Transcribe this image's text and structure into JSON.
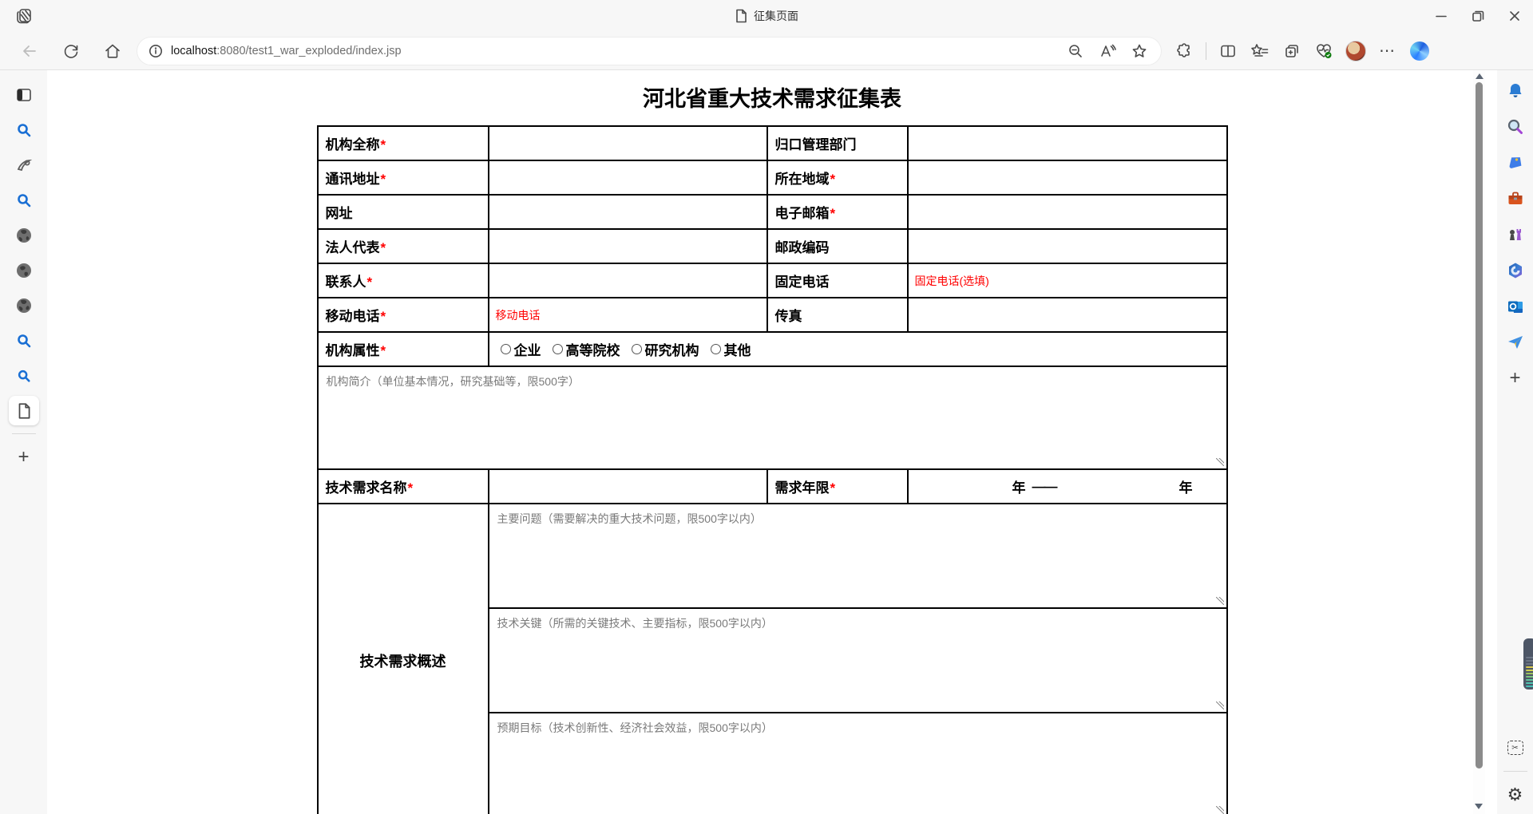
{
  "window": {
    "tab_title": "征集页面"
  },
  "toolbar": {
    "url": {
      "host": "localhost",
      "path": ":8080/test1_war_exploded/index.jsp"
    }
  },
  "icons": {
    "more": "⋯",
    "plus": "+",
    "gear": "⚙",
    "scissors": "✂",
    "read_aloud": "A"
  },
  "page": {
    "title": "河北省重大技术需求征集表",
    "required_mark": "*",
    "form": {
      "org_name_label": "机构全称",
      "dept_label": "归口管理部门",
      "address_label": "通讯地址",
      "region_label": "所在地域",
      "website_label": "网址",
      "email_label": "电子邮箱",
      "legal_label": "法人代表",
      "postcode_label": "邮政编码",
      "contact_label": "联系人",
      "landline_label": "固定电话",
      "landline_placeholder": "固定电话(选填)",
      "mobile_label": "移动电话",
      "mobile_placeholder": "移动电话",
      "fax_label": "传真",
      "org_type_label": "机构属性",
      "org_type_options": [
        "企业",
        "高等院校",
        "研究机构",
        "其他"
      ],
      "org_intro_placeholder": "机构简介（单位基本情况，研究基础等，限500字）",
      "demand_name_label": "技术需求名称",
      "demand_years_label": "需求年限",
      "year_suffix": "年",
      "year_separator": "——",
      "overview_label": "技术需求概述",
      "main_problem_placeholder": "主要问题（需要解决的重大技术问题，限500字以内）",
      "key_tech_placeholder": "技术关键（所需的关键技术、主要指标，限500字以内）",
      "expected_goal_placeholder": "预期目标（技术创新性、经济社会效益，限500字以内）"
    }
  }
}
